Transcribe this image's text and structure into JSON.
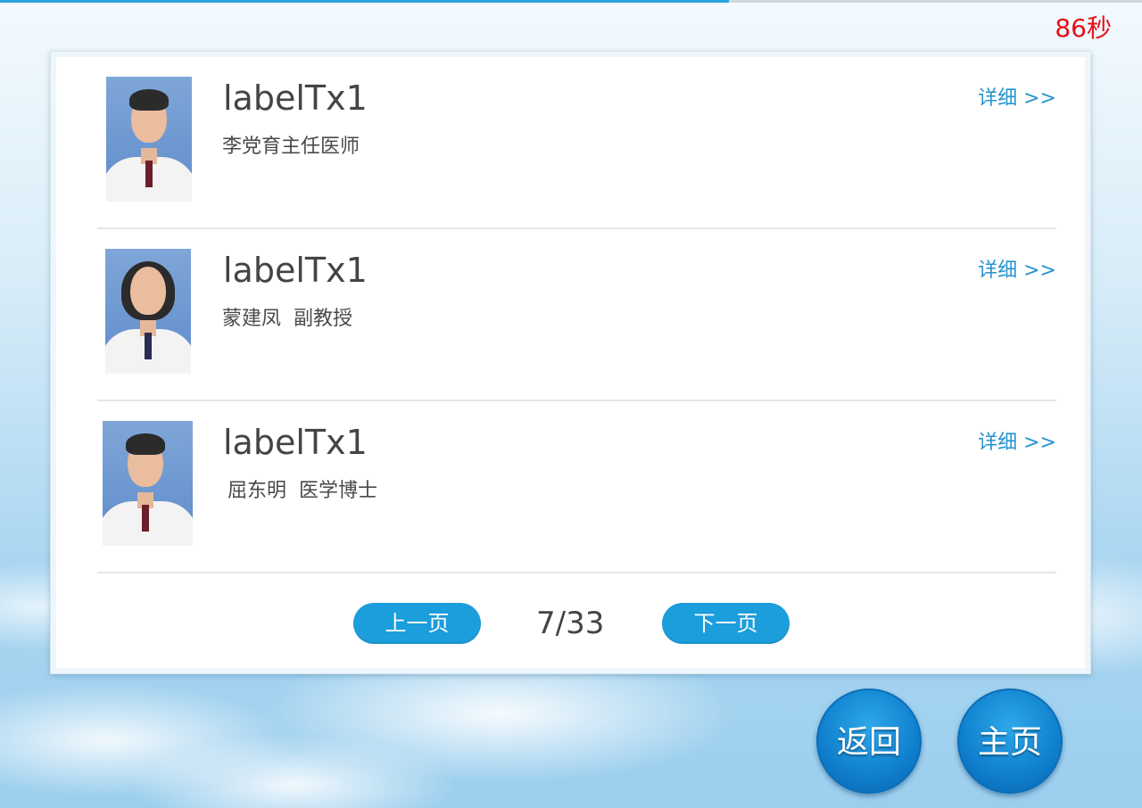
{
  "header": {
    "progress_fraction": 0.638,
    "countdown": "86秒"
  },
  "doctors": [
    {
      "name": "labelTx1",
      "title": "李党育主任医师",
      "detail_label": "详细 >>"
    },
    {
      "name": "labelTx1",
      "title": "蒙建凤  副教授",
      "detail_label": "详细 >>"
    },
    {
      "name": "labelTx1",
      "title": "屈东明  医学博士",
      "detail_label": "详细 >>"
    }
  ],
  "pager": {
    "prev_label": "上一页",
    "indicator": "7/33",
    "next_label": "下一页"
  },
  "footer": {
    "back_label": "返回",
    "home_label": "主页"
  },
  "colors": {
    "accent": "#1c9ddc",
    "countdown": "#e50f14",
    "link": "#2592d0"
  }
}
